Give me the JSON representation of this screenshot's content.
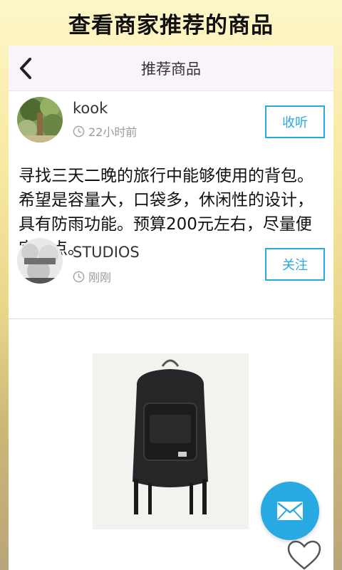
{
  "banner": {
    "title": "查看商家推荐的商品"
  },
  "header": {
    "title": "推荐商品"
  },
  "posts": [
    {
      "user": "kook",
      "time": "22小时前",
      "action_label": "收听",
      "text": "寻找三天二晚的旅行中能够使用的背包。希望是容量大，口袋多，休闲性的设计，具有防雨功能。预算200元左右，尽量便宜一点。"
    },
    {
      "user": "STUDIOS",
      "time": "刚刚",
      "action_label": "关注"
    }
  ],
  "icons": {
    "back": "back-chevron-icon",
    "clock": "clock-icon",
    "mail": "mail-icon",
    "heart": "heart-outline-icon"
  },
  "colors": {
    "accent": "#29a9e1",
    "header_bg": "#fbf3fb"
  }
}
